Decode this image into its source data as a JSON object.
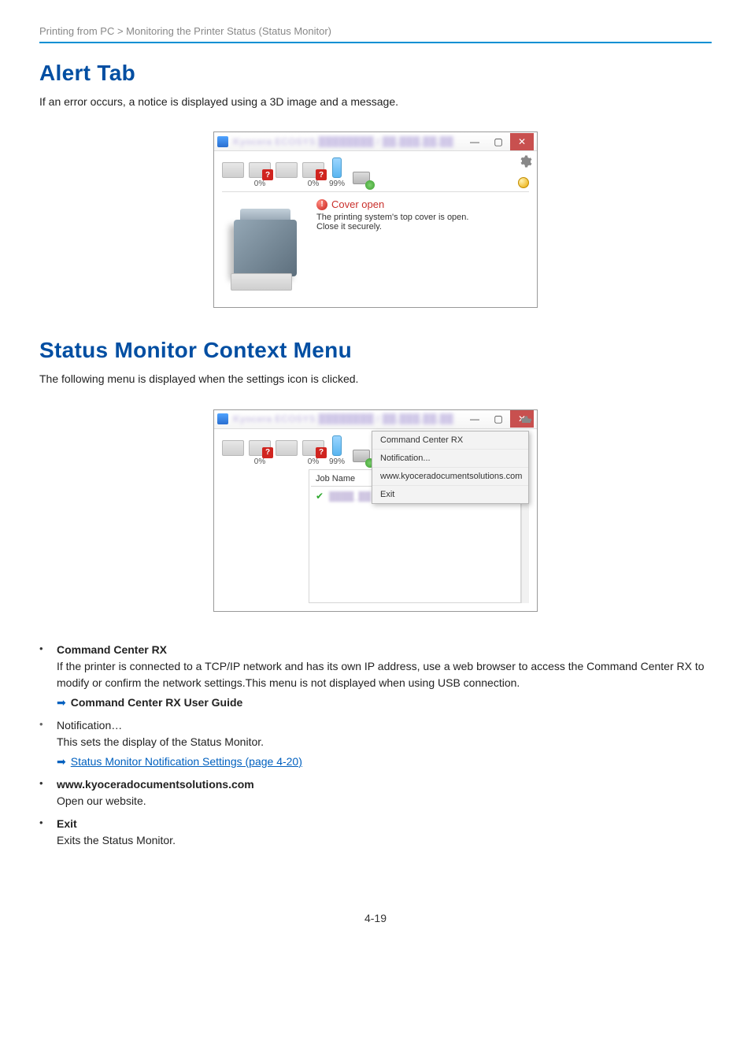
{
  "breadcrumb": "Printing from PC > Monitoring the Printer Status (Status Monitor)",
  "section_alert": {
    "heading": "Alert Tab",
    "intro": "If an error occurs, a notice is displayed using a 3D image and a message."
  },
  "window_alert": {
    "title": "Kyocera ECOSYS ████████ / ██.███.██.██",
    "tray_percents": [
      "0%",
      "0%",
      "99%"
    ],
    "error_title": "Cover open",
    "error_line1": "The printing system's top cover is open.",
    "error_line2": "Close it securely."
  },
  "section_context": {
    "heading": "Status Monitor Context Menu",
    "intro": "The following menu is displayed when the settings icon is clicked."
  },
  "window_context": {
    "title": "Kyocera ECOSYS ████████ / ██.███.██.██",
    "tray_percents": [
      "0%",
      "0%",
      "99%"
    ],
    "job_header": "Job Name",
    "job_row": "████_██",
    "menu": [
      "Command Center RX",
      "Notification...",
      "www.kyoceradocumentsolutions.com",
      "Exit"
    ]
  },
  "bullets": [
    {
      "bullet": "•",
      "title": "Command Center RX",
      "title_bold": true,
      "desc": "If the printer is connected to a TCP/IP network and has its own IP address, use a web browser to access the Command Center RX to modify or confirm the network settings.This menu is not displayed when using USB connection.",
      "ref_bold": "Command Center RX User Guide"
    },
    {
      "bullet": "•",
      "title": "Notification…",
      "title_bold": false,
      "desc": "This sets the display of the Status Monitor.",
      "ref_link": "Status Monitor Notification Settings (page 4-20)"
    },
    {
      "bullet": "•",
      "title": "www.kyoceradocumentsolutions.com",
      "title_bold": true,
      "desc": "Open our website."
    },
    {
      "bullet": "•",
      "title": "Exit",
      "title_bold": true,
      "desc": "Exits the Status Monitor."
    }
  ],
  "page_number": "4-19"
}
